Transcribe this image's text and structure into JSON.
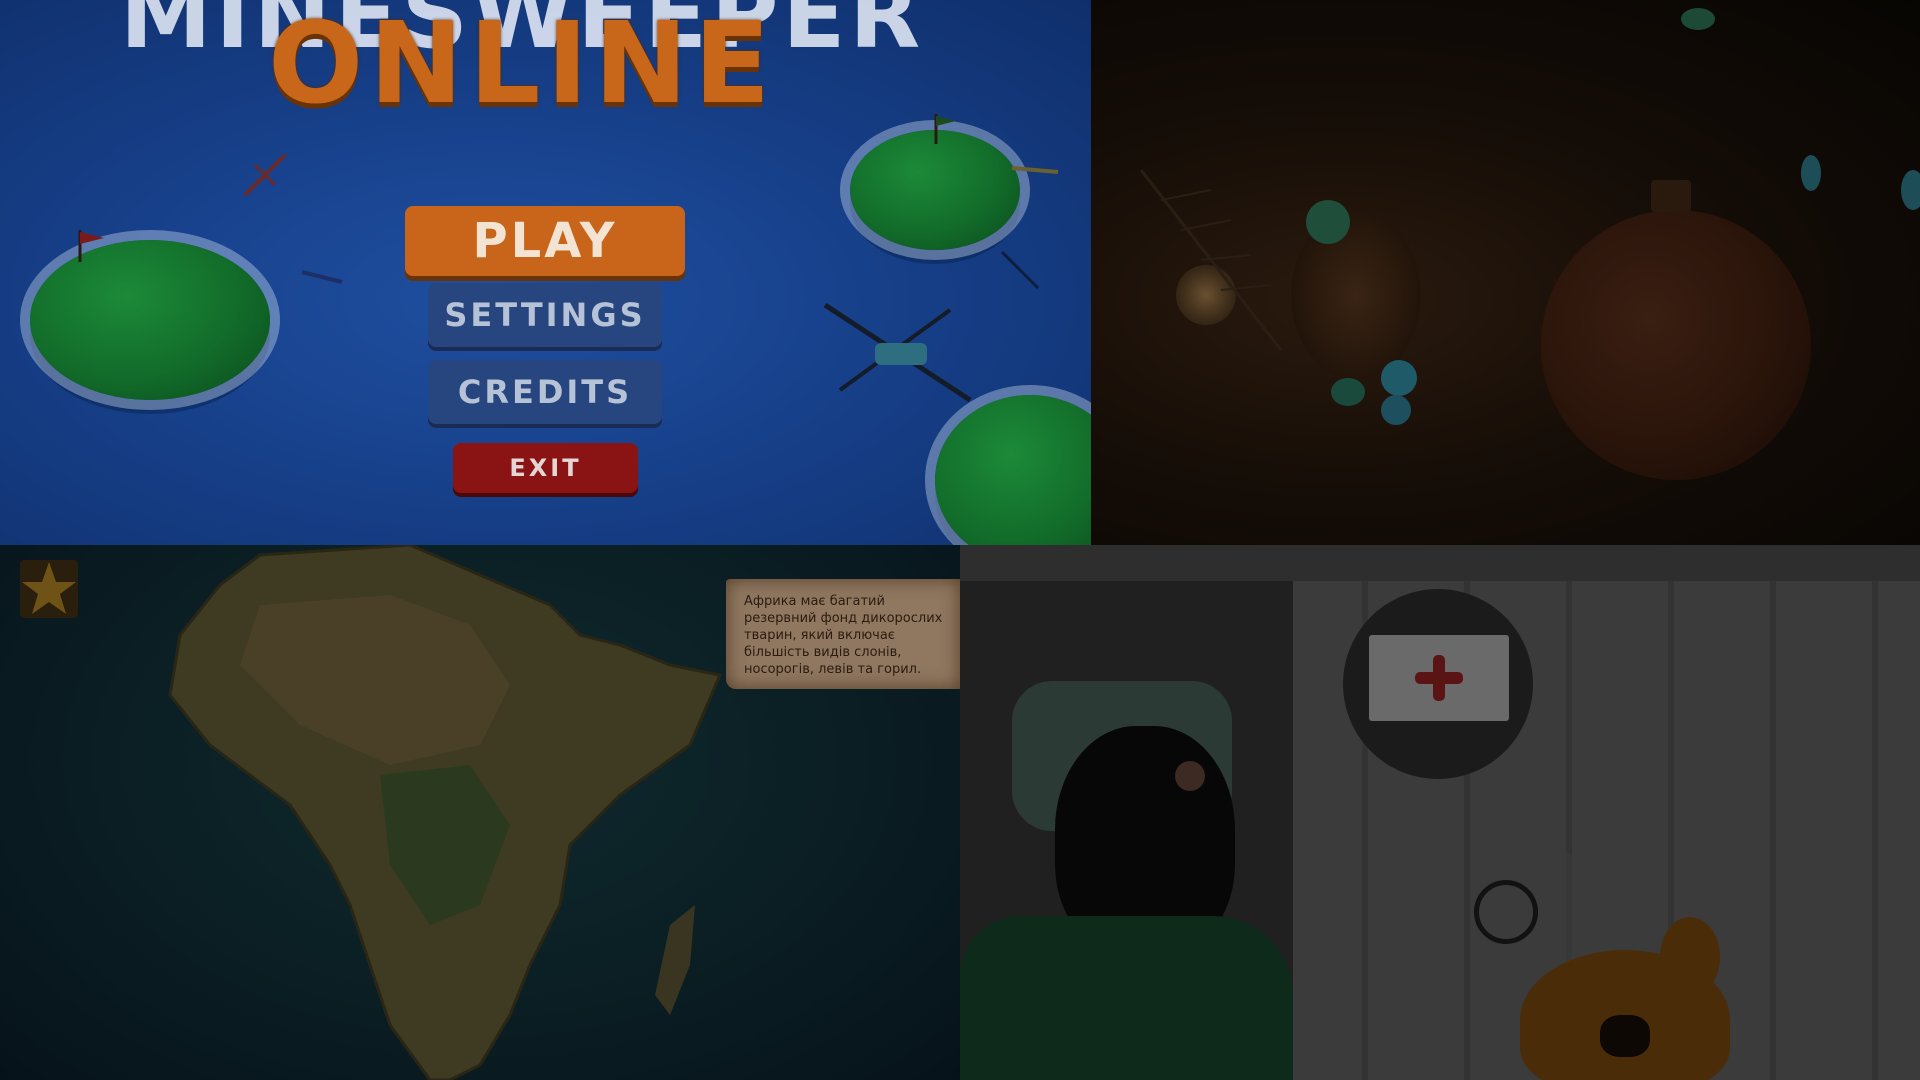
{
  "minesweeper": {
    "title_back": "MINESWEEPER",
    "title_front": "ONLINE",
    "menu": {
      "play": "PLAY",
      "settings": "SETTINGS",
      "credits": "CREDITS",
      "exit": "EXIT"
    }
  },
  "africa": {
    "info_text": "Африка має багатий резервний фонд дикорослих тварин, який включає більшість видів слонів, носорогів, левів та горил."
  },
  "colors": {
    "play_orange": "#c8651b",
    "menu_blue": "#27457e",
    "exit_red": "#8a1414",
    "ocean": "#17408a"
  }
}
